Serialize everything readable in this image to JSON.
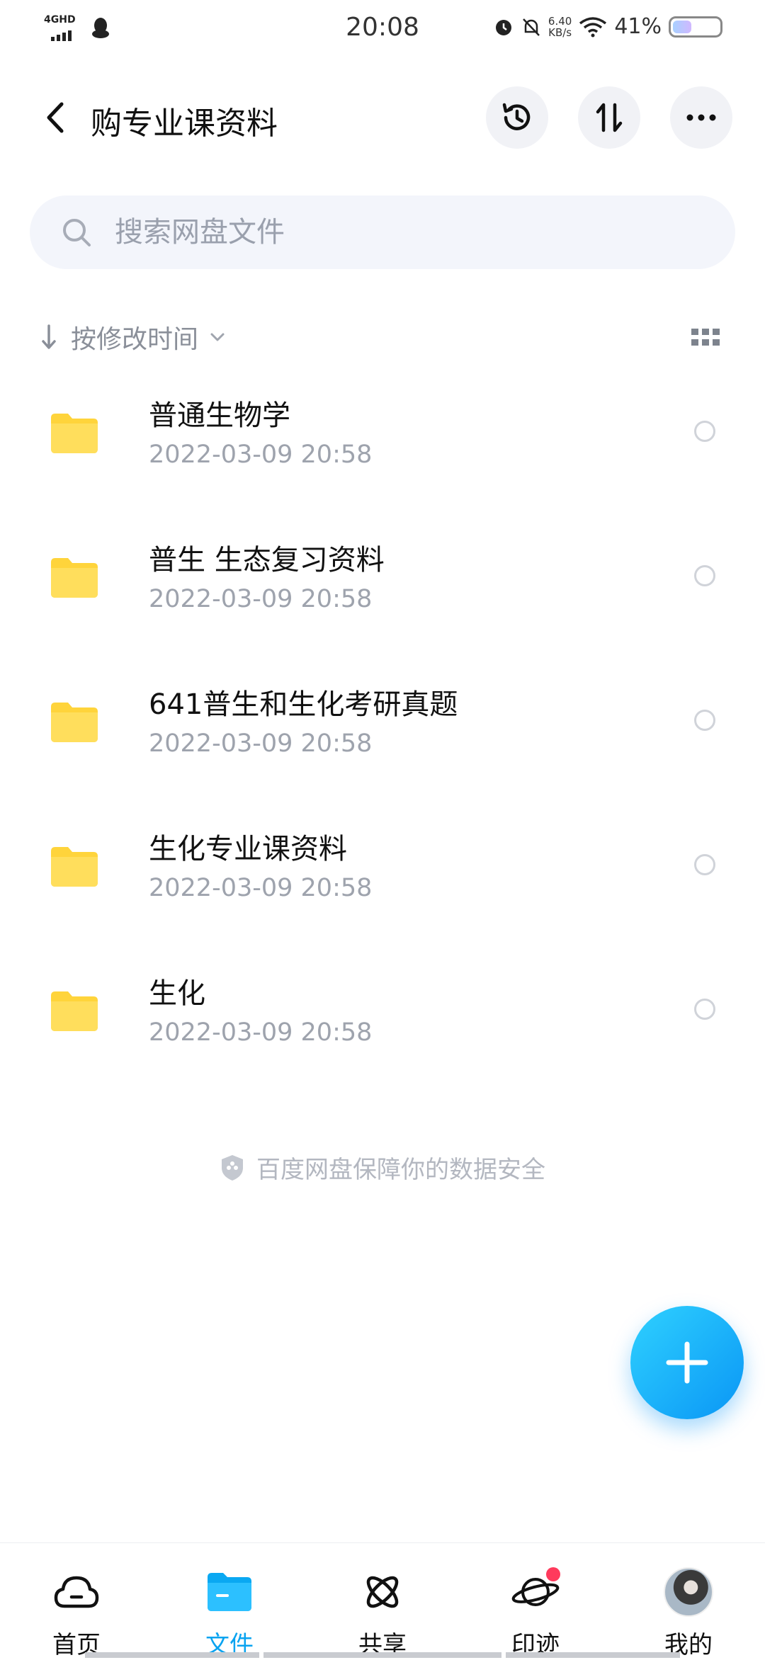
{
  "status_bar": {
    "network": "4GHD",
    "time": "20:08",
    "speed_top": "6.40",
    "speed_unit": "KB/s",
    "battery_percent": "41%",
    "battery_level": 0.41
  },
  "header": {
    "title": "购专业课资料"
  },
  "search": {
    "placeholder": "搜索网盘文件"
  },
  "sort": {
    "label": "按修改时间"
  },
  "files": [
    {
      "name": "普通生物学",
      "date": "2022-03-09  20:58"
    },
    {
      "name": "普生 生态复习资料",
      "date": "2022-03-09  20:58"
    },
    {
      "name": "641普生和生化考研真题",
      "date": "2022-03-09  20:58"
    },
    {
      "name": "生化专业课资料",
      "date": "2022-03-09  20:58"
    },
    {
      "name": "生化",
      "date": "2022-03-09  20:58"
    }
  ],
  "footer_note": "百度网盘保障你的数据安全",
  "bottom_nav": [
    {
      "label": "首页",
      "icon": "cloud-icon",
      "active": false
    },
    {
      "label": "文件",
      "icon": "folder-icon",
      "active": true
    },
    {
      "label": "共享",
      "icon": "share-atom-icon",
      "active": false
    },
    {
      "label": "印迹",
      "icon": "planet-icon",
      "active": false
    },
    {
      "label": "我的",
      "icon": "avatar",
      "active": false
    }
  ],
  "colors": {
    "accent": "#09a3f0",
    "folder": "#ffd43b",
    "badge": "#ff3a5c"
  }
}
